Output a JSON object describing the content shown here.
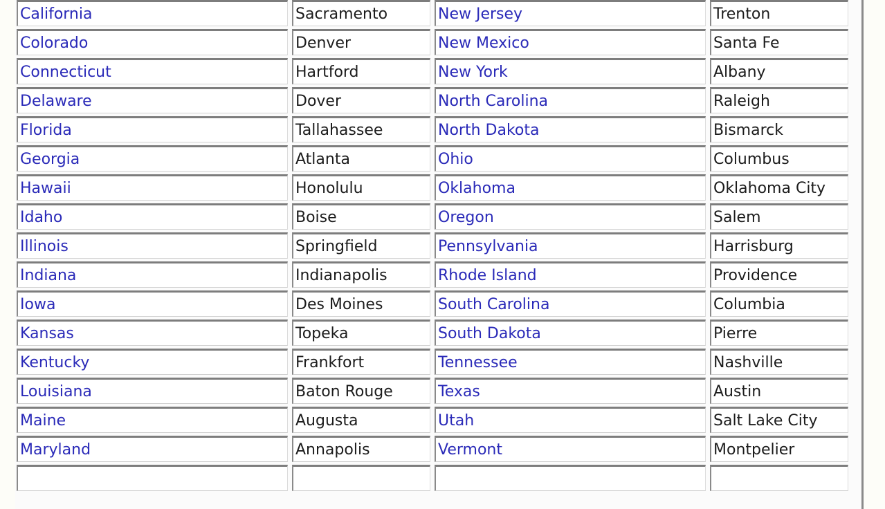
{
  "table": {
    "rows": [
      {
        "state_a": "California",
        "capital_a": "Sacramento",
        "state_b": "New Jersey",
        "capital_b": "Trenton"
      },
      {
        "state_a": "Colorado",
        "capital_a": "Denver",
        "state_b": "New Mexico",
        "capital_b": "Santa Fe"
      },
      {
        "state_a": "Connecticut",
        "capital_a": "Hartford",
        "state_b": "New York",
        "capital_b": "Albany"
      },
      {
        "state_a": "Delaware",
        "capital_a": "Dover",
        "state_b": "North Carolina",
        "capital_b": "Raleigh"
      },
      {
        "state_a": "Florida",
        "capital_a": "Tallahassee",
        "state_b": "North Dakota",
        "capital_b": "Bismarck"
      },
      {
        "state_a": "Georgia",
        "capital_a": "Atlanta",
        "state_b": "Ohio",
        "capital_b": "Columbus"
      },
      {
        "state_a": "Hawaii",
        "capital_a": "Honolulu",
        "state_b": "Oklahoma",
        "capital_b": "Oklahoma City"
      },
      {
        "state_a": "Idaho",
        "capital_a": "Boise",
        "state_b": "Oregon",
        "capital_b": "Salem"
      },
      {
        "state_a": "Illinois",
        "capital_a": "Springfield",
        "state_b": "Pennsylvania",
        "capital_b": "Harrisburg"
      },
      {
        "state_a": "Indiana",
        "capital_a": "Indianapolis",
        "state_b": "Rhode Island",
        "capital_b": "Providence"
      },
      {
        "state_a": "Iowa",
        "capital_a": "Des Moines",
        "state_b": "South Carolina",
        "capital_b": "Columbia"
      },
      {
        "state_a": "Kansas",
        "capital_a": "Topeka",
        "state_b": "South Dakota",
        "capital_b": "Pierre"
      },
      {
        "state_a": "Kentucky",
        "capital_a": "Frankfort",
        "state_b": "Tennessee",
        "capital_b": "Nashville"
      },
      {
        "state_a": "Louisiana",
        "capital_a": "Baton Rouge",
        "state_b": "Texas",
        "capital_b": "Austin"
      },
      {
        "state_a": "Maine",
        "capital_a": "Augusta",
        "state_b": "Utah",
        "capital_b": "Salt Lake City"
      },
      {
        "state_a": "Maryland",
        "capital_a": "Annapolis",
        "state_b": "Vermont",
        "capital_b": "Montpelier"
      },
      {
        "state_a": "",
        "capital_a": "",
        "state_b": "",
        "capital_b": ""
      }
    ]
  },
  "colors": {
    "link": "#2a2ab8",
    "text": "#1c1c1c",
    "border": "#7d7d7d"
  }
}
